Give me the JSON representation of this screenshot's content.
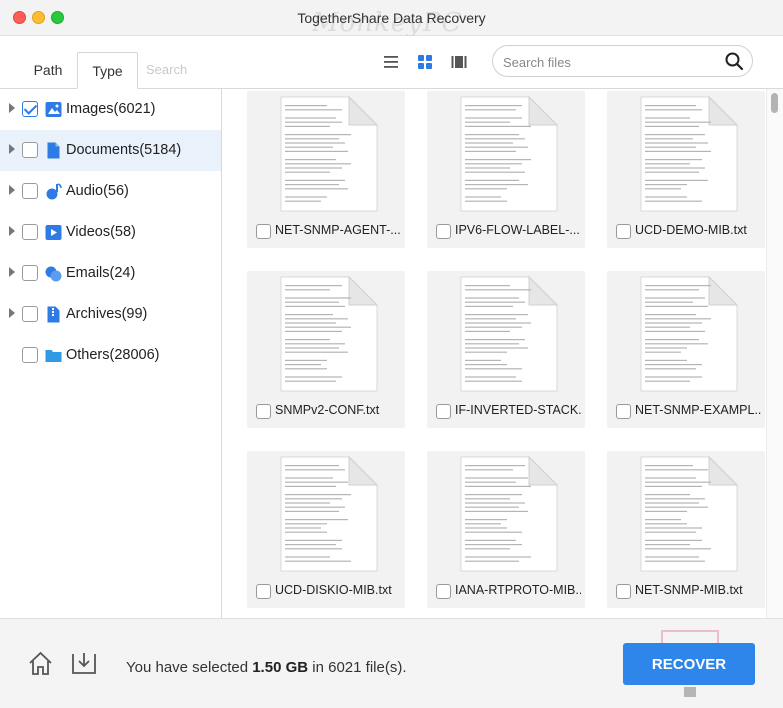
{
  "window": {
    "title": "TogetherShare Data Recovery",
    "watermark": "MonkeyPC"
  },
  "toolbar": {
    "tabs": [
      {
        "label": "Path",
        "active": false
      },
      {
        "label": "Type",
        "active": true
      }
    ],
    "sidebar_search_placeholder": "Search",
    "view_modes": [
      {
        "icon": "list-view-icon",
        "active": false
      },
      {
        "icon": "grid-view-icon",
        "active": true
      },
      {
        "icon": "preview-view-icon",
        "active": false
      }
    ],
    "search": {
      "placeholder": "Search files",
      "value": ""
    }
  },
  "sidebar": {
    "categories": [
      {
        "label": "Images(6021)",
        "checked": true,
        "expandable": true,
        "selected": false,
        "icon": "images-icon",
        "color": "#2f7be6"
      },
      {
        "label": "Documents(5184)",
        "checked": false,
        "expandable": true,
        "selected": true,
        "icon": "document-icon",
        "color": "#2f7be6"
      },
      {
        "label": "Audio(56)",
        "checked": false,
        "expandable": true,
        "selected": false,
        "icon": "audio-icon",
        "color": "#2f7be6"
      },
      {
        "label": "Videos(58)",
        "checked": false,
        "expandable": true,
        "selected": false,
        "icon": "video-icon",
        "color": "#2f7be6"
      },
      {
        "label": "Emails(24)",
        "checked": false,
        "expandable": true,
        "selected": false,
        "icon": "email-icon",
        "color": "#2f7be6"
      },
      {
        "label": "Archives(99)",
        "checked": false,
        "expandable": true,
        "selected": false,
        "icon": "archive-icon",
        "color": "#2f7be6"
      },
      {
        "label": "Others(28006)",
        "checked": false,
        "expandable": false,
        "selected": false,
        "icon": "folder-icon",
        "color": "#2f9be6"
      }
    ]
  },
  "files": [
    {
      "name": "NET-SNMP-AGENT-...",
      "checked": false
    },
    {
      "name": "IPV6-FLOW-LABEL-...",
      "checked": false
    },
    {
      "name": "UCD-DEMO-MIB.txt",
      "checked": false
    },
    {
      "name": "SNMPv2-CONF.txt",
      "checked": false
    },
    {
      "name": "IF-INVERTED-STACK...",
      "checked": false
    },
    {
      "name": "NET-SNMP-EXAMPL...",
      "checked": false
    },
    {
      "name": "UCD-DISKIO-MIB.txt",
      "checked": false
    },
    {
      "name": "IANA-RTPROTO-MIB...",
      "checked": false
    },
    {
      "name": "NET-SNMP-MIB.txt",
      "checked": false
    }
  ],
  "footer": {
    "status_prefix": "You have selected ",
    "selected_size": "1.50 GB",
    "status_middle": " in ",
    "file_count": "6021",
    "status_suffix": " file(s).",
    "recover_label": "RECOVER",
    "accent": "#2f86ea"
  }
}
